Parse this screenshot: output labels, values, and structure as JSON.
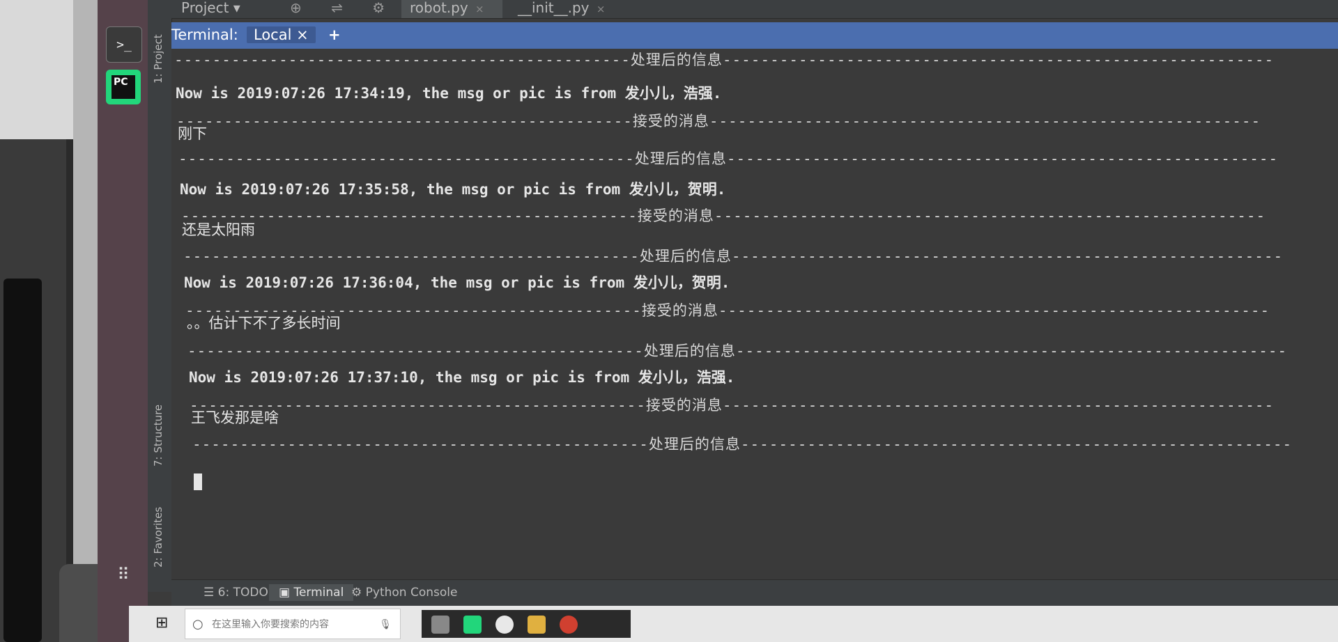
{
  "colors": {
    "terminal_bg": "#3a3a3a",
    "tool_window_header": "#4b6eaf",
    "ide_chrome": "#3c3f41",
    "launcher": "#55424a",
    "pycharm_icon": "#22d67b"
  },
  "editor_tabs": {
    "project": "Project ▾",
    "toolbar_icons": "⊕ ⇌ ⚙ —",
    "robot": "robot.py",
    "init": "__init__.py",
    "close": "×"
  },
  "side_tools": {
    "project": "1: Project",
    "structure": "7: Structure",
    "favorites": "2: Favorites"
  },
  "launcher": {
    "terminal_glyph": ">_",
    "pycharm_label": "PC",
    "apps_glyph": "⠿"
  },
  "terminal": {
    "title": "Terminal:",
    "tab": "Local ×",
    "add": "+",
    "lines": [
      {
        "kind": "sep",
        "text": "------------------------------------------------处理后的信息----------------------------------------------------------"
      },
      {
        "kind": "msg",
        "text": "Now is 2019:07:26 17:34:19, the msg or pic is from 发小儿，浩强."
      },
      {
        "kind": "sep",
        "text": "------------------------------------------------接受的消息----------------------------------------------------------"
      },
      {
        "kind": "text",
        "text": "刚下"
      },
      {
        "kind": "sep",
        "text": "------------------------------------------------处理后的信息----------------------------------------------------------"
      },
      {
        "kind": "msg",
        "text": "Now is 2019:07:26 17:35:58, the msg or pic is from 发小儿，贺明."
      },
      {
        "kind": "sep",
        "text": "------------------------------------------------接受的消息----------------------------------------------------------"
      },
      {
        "kind": "text",
        "text": "还是太阳雨"
      },
      {
        "kind": "sep",
        "text": "------------------------------------------------处理后的信息----------------------------------------------------------"
      },
      {
        "kind": "msg",
        "text": "Now is 2019:07:26 17:36:04, the msg or pic is from 发小儿，贺明."
      },
      {
        "kind": "sep",
        "text": "------------------------------------------------接受的消息----------------------------------------------------------"
      },
      {
        "kind": "text",
        "text": "。。估计下不了多长时间"
      },
      {
        "kind": "sep",
        "text": "------------------------------------------------处理后的信息----------------------------------------------------------"
      },
      {
        "kind": "msg",
        "text": "Now is 2019:07:26 17:37:10, the msg or pic is from 发小儿，浩强."
      },
      {
        "kind": "sep",
        "text": "------------------------------------------------接受的消息----------------------------------------------------------"
      },
      {
        "kind": "text",
        "text": "王飞发那是啥"
      },
      {
        "kind": "sep",
        "text": "------------------------------------------------处理后的信息----------------------------------------------------------"
      }
    ]
  },
  "bottom_tools": {
    "todo": "☰ 6: TODO",
    "terminal": "▣ Terminal",
    "python_console": "⚙ Python Console"
  },
  "taskbar": {
    "start_glyph": "⊞",
    "search_placeholder": "在这里输入你要搜索的内容",
    "search_glyph": "○",
    "mic_glyph": "🎙"
  }
}
